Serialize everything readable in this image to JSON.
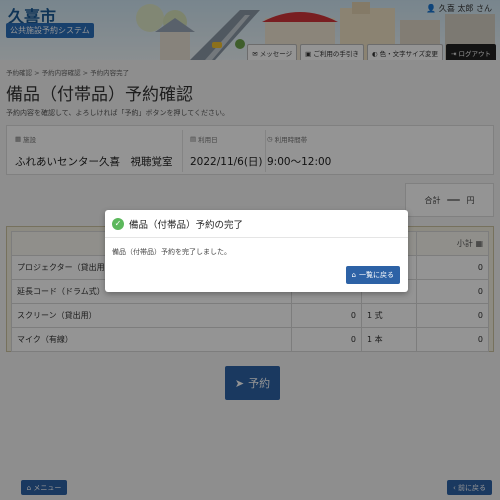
{
  "header": {
    "city_name": "久喜市",
    "system_name": "公共施設予約システム",
    "user": "久喜 太郎 さん",
    "buttons": [
      "メッセージ",
      "ご利用の手引き",
      "色・文字サイズ変更",
      "ログアウト"
    ]
  },
  "breadcrumb": "予約確認 > 予約内容確認 > 予約内容完了",
  "page": {
    "title": "備品（付帯品）予約確認",
    "lead": "予約内容を確認して、よろしければ「予約」ボタンを押してください。"
  },
  "info": {
    "facility_label": "施設",
    "facility_value": "ふれあいセンター久喜　視聴覚室",
    "date_label": "利用日",
    "date_value": "2022/11/6(日)",
    "time_label": "利用時間帯",
    "time_value": "9:00～12:00"
  },
  "total": {
    "label": "合計",
    "value": "—",
    "unit": "円"
  },
  "table": {
    "subtotal_header": "小計",
    "rows": [
      {
        "name": "プロジェクター（貸出用",
        "qty": "",
        "unit": "",
        "subtotal": "0"
      },
      {
        "name": "延長コード（ドラム式）",
        "qty": "",
        "unit": "",
        "subtotal": "0"
      },
      {
        "name": "スクリーン（貸出用）",
        "qty": "0",
        "unit": "1 式",
        "subtotal": "0"
      },
      {
        "name": "マイク（有線）",
        "qty": "0",
        "unit": "1 本",
        "subtotal": "0"
      }
    ]
  },
  "reserve_label": "予約",
  "footer": {
    "menu_label": "メニュー",
    "back_label": "前に戻る"
  },
  "modal": {
    "title": "備品（付帯品）予約の完了",
    "message": "備品（付帯品）予約を完了しました。",
    "button_label": "一覧に戻る"
  },
  "colors": {
    "primary": "#2d62a6",
    "success": "#5cb85c"
  }
}
